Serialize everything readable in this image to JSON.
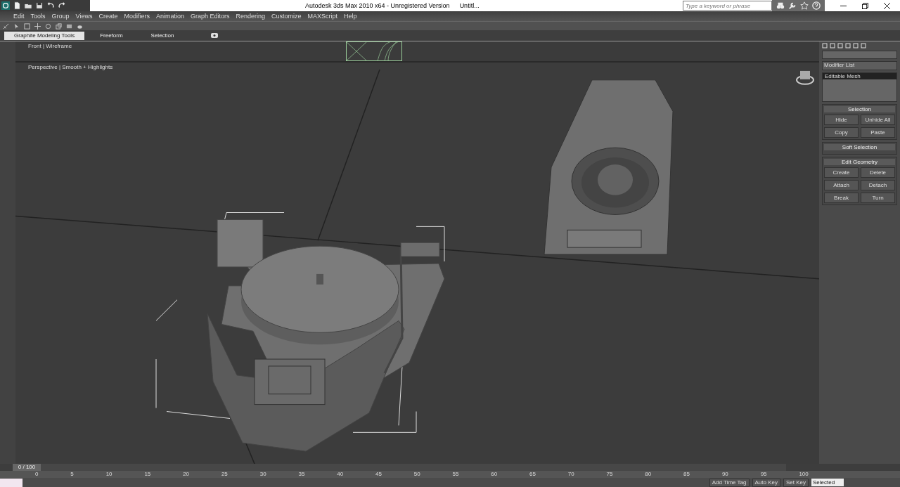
{
  "window": {
    "title": "Autodesk 3ds Max  2010 x64   - Unregistered Version",
    "document": "Untitl..."
  },
  "search": {
    "placeholder": "Type a keyword or phrase"
  },
  "menu": [
    "Edit",
    "Tools",
    "Group",
    "Views",
    "Create",
    "Modifiers",
    "Animation",
    "Graph Editors",
    "Rendering",
    "Customize",
    "MAXScript",
    "Help"
  ],
  "ribbon_tabs": [
    {
      "label": "Graphite Modeling Tools",
      "selected": true
    },
    {
      "label": "Freeform",
      "selected": false
    },
    {
      "label": "Selection",
      "selected": false
    }
  ],
  "viewports": [
    {
      "label": "Front | Wireframe"
    },
    {
      "label": "Perspective | Smooth + Highlights"
    }
  ],
  "command_panel": {
    "modifier_list": "Modifier List",
    "stack": [
      {
        "label": "Editable Mesh",
        "selected": true
      }
    ],
    "rollouts": [
      {
        "title": "Selection",
        "buttons": [
          "Hide",
          "Unhide All",
          "Copy",
          "Paste"
        ]
      },
      {
        "title": "Soft Selection"
      },
      {
        "title": "Edit Geometry",
        "buttons": [
          "Create",
          "Delete",
          "Attach",
          "Detach",
          "Break",
          "Turn"
        ]
      }
    ]
  },
  "timeline": {
    "frame": "0 / 100",
    "level": 0,
    "ticks": [
      "0",
      "5",
      "10",
      "15",
      "20",
      "25",
      "30",
      "35",
      "40",
      "45",
      "50",
      "55",
      "60",
      "65",
      "70",
      "75",
      "80",
      "85",
      "90",
      "95",
      "100"
    ]
  },
  "status": {
    "key_filter": "Selected",
    "add_time_tag": "Add Time Tag",
    "auto_key": "Auto Key",
    "set_key": "Set Key"
  }
}
